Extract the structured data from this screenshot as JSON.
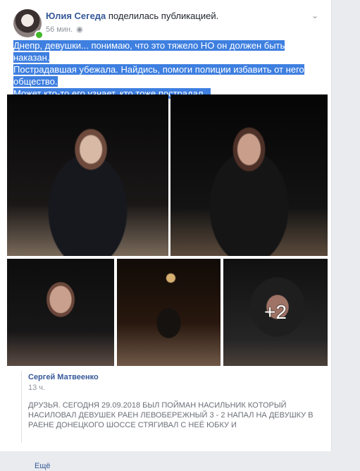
{
  "post": {
    "author": "Юлия Сегеда",
    "action": " поделилась публикацией.",
    "time": "56 мин.",
    "privacy_icon": "globe-icon",
    "text_lines": [
      "Днепр, девушки... понимаю, что это тяжело НО он должен быть наказан.",
      "Пострадавшая убежала. Найдись, помоги полиции избавить от него",
      "общество.",
      "Может кто-то его узнает, кто тоже пострадал..."
    ]
  },
  "photos": {
    "more_count": "+2"
  },
  "comment": {
    "author": "Сергей Матвеенко",
    "time": "13 ч.",
    "text": "Друзья. СЕГОДНЯ 29.09.2018 БЫЛ ПОЙМАН НАСИЛЬНИК КОТОРЫЙ НАСИЛОВАЛ ДЕВУШЕК РАЕН ЛЕВОБЕРЕЖНЫЙ 3 - 2 НАПАЛ НА ДЕВУШКУ В РАЕНЕ ДОНЕЦКОГО ШОССЕ СТЯГИВАЛ С НЕЁ ЮБКУ И",
    "more": "Ещё"
  },
  "colors": {
    "facebook_blue": "#365899",
    "selection_blue": "#3e7fe0",
    "background": "#e9ebee"
  }
}
